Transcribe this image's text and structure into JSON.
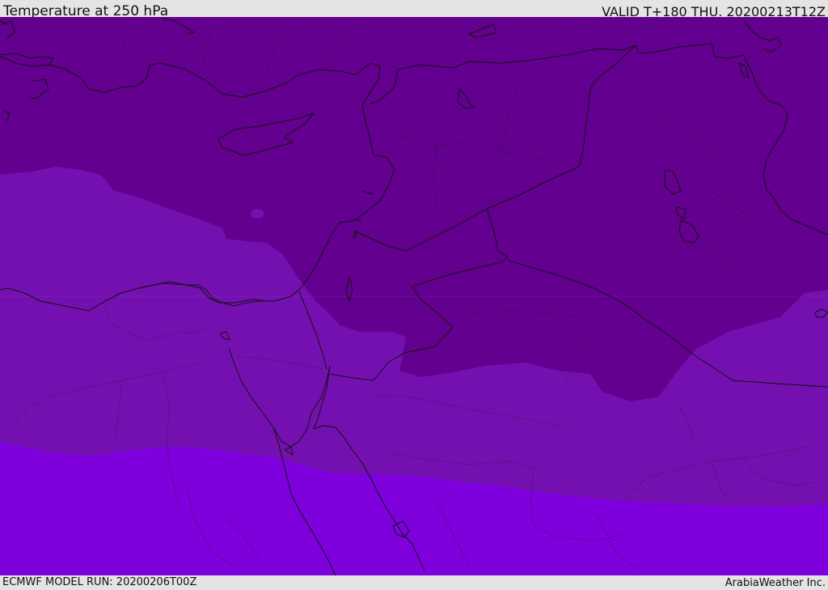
{
  "header": {
    "title": "Temperature at 250 hPa",
    "valid": "VALID T+180 THU. 20200213T12Z"
  },
  "footer": {
    "model_run": "ECMWF MODEL RUN: 20200206T00Z",
    "credit": "ArabiaWeather Inc."
  },
  "map": {
    "colors": {
      "band_dark": "#63008f",
      "band_mid": "#7510b0",
      "band_bright": "#7e00dc",
      "coast": "#111111",
      "borders": "#222222"
    }
  }
}
